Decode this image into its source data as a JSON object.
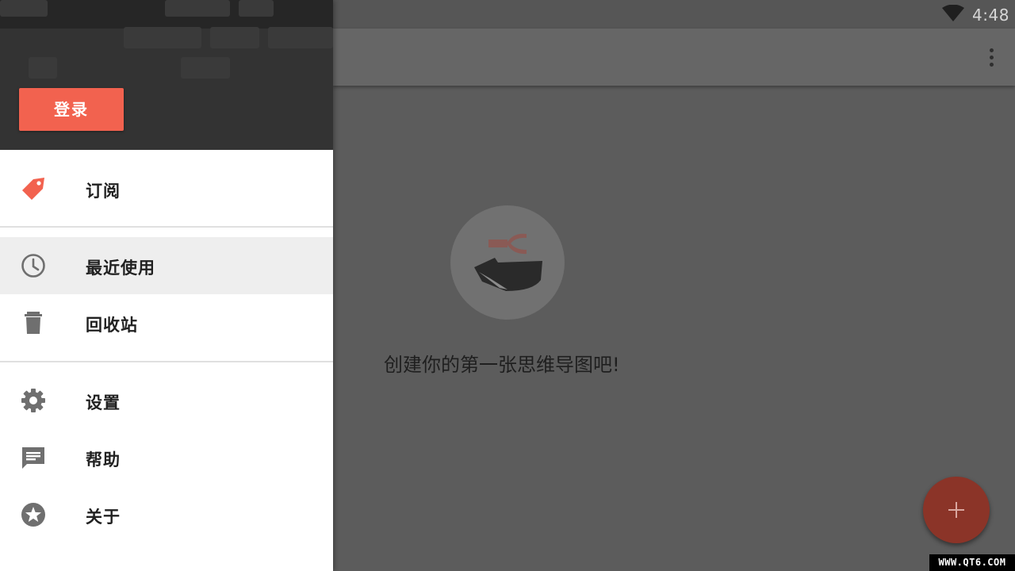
{
  "status_bar": {
    "time": "4:48"
  },
  "drawer": {
    "login_label": "登录",
    "items": [
      {
        "label": "订阅",
        "icon": "tag-icon"
      },
      {
        "label": "最近使用",
        "icon": "clock-icon",
        "selected": true
      },
      {
        "label": "回收站",
        "icon": "trash-icon"
      },
      {
        "label": "设置",
        "icon": "gear-icon"
      },
      {
        "label": "帮助",
        "icon": "feedback-icon"
      },
      {
        "label": "关于",
        "icon": "star-circle-icon"
      }
    ]
  },
  "main": {
    "empty_message": "创建你的第一张思维导图吧!"
  },
  "fab": {
    "icon": "plus-icon"
  },
  "watermark": "WWW.QT6.COM",
  "colors": {
    "accent": "#f2624f",
    "drawer_header": "#333333",
    "scrim": "#5c5c5c",
    "icon_gray": "#6f6f6f"
  }
}
